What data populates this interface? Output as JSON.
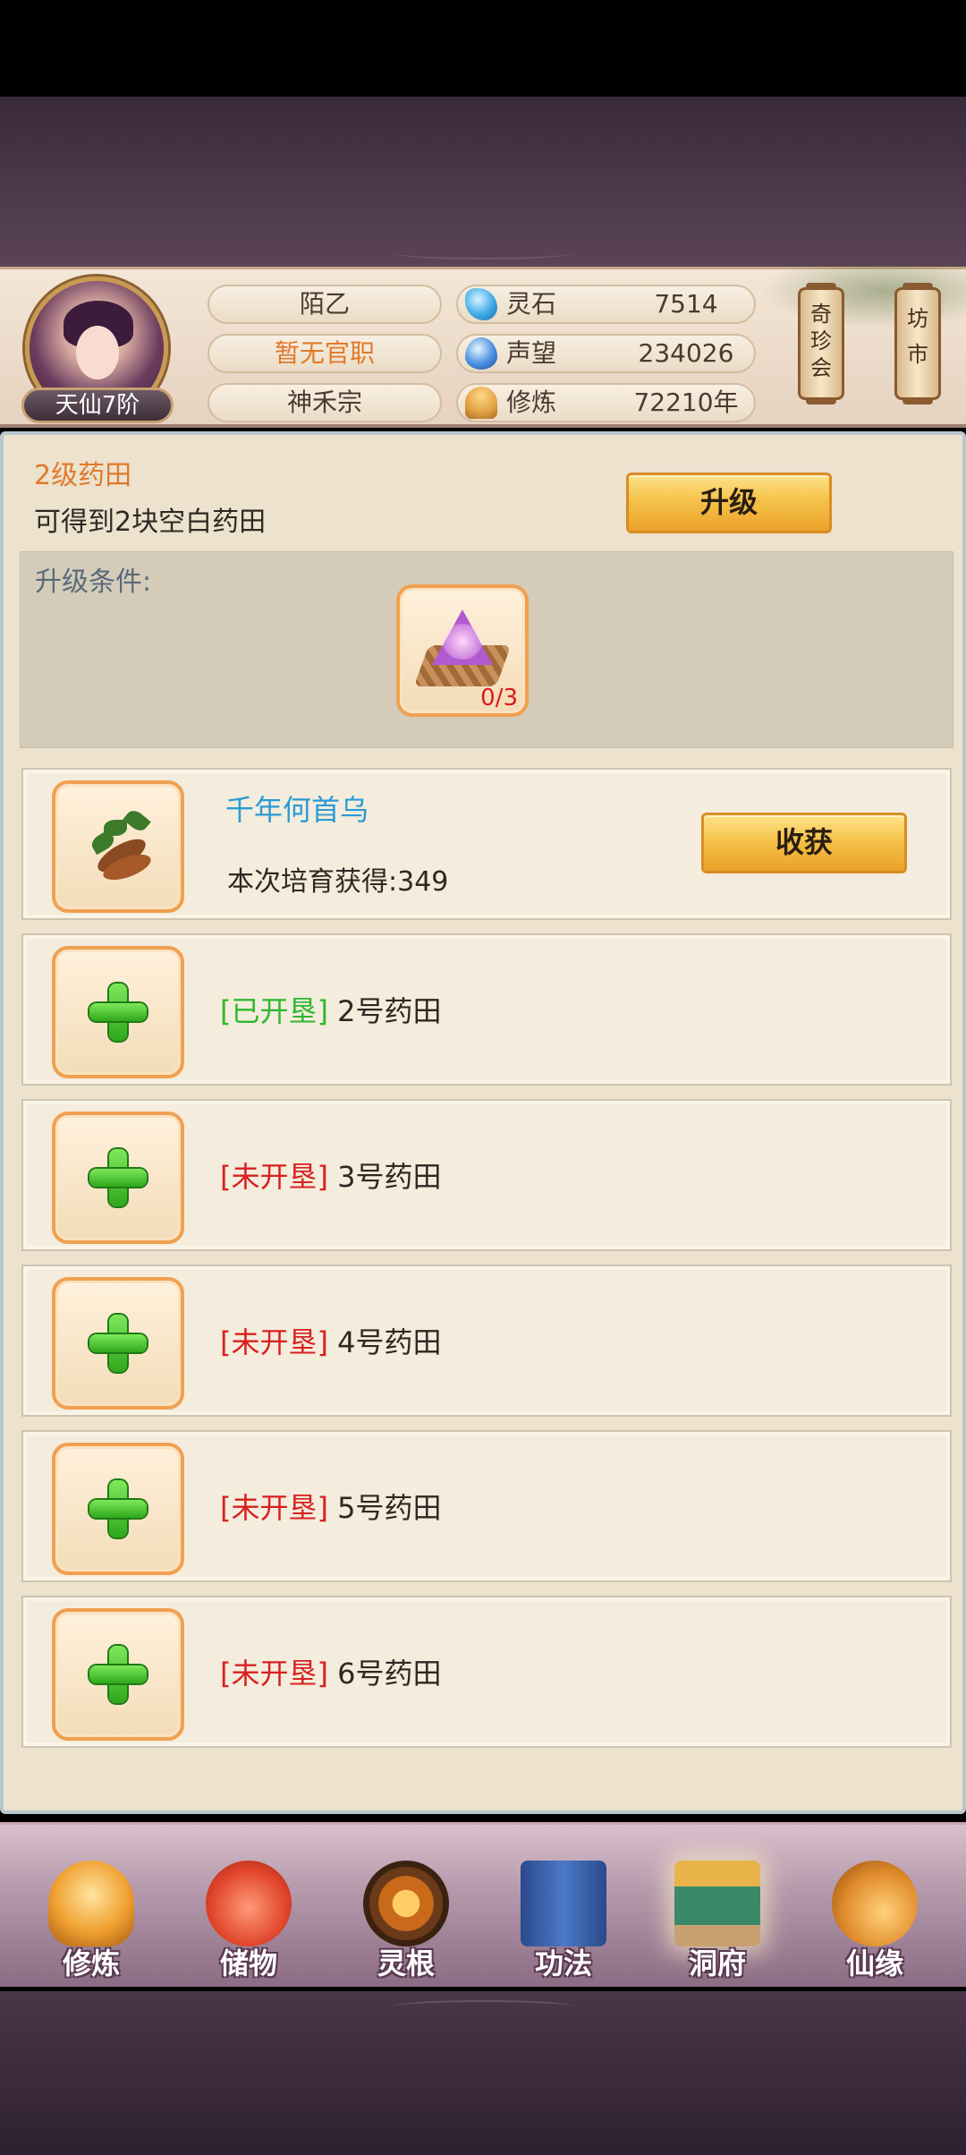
{
  "header": {
    "rank": "天仙7阶",
    "name": "陌乙",
    "title": "暂无官职",
    "sect": "神禾宗",
    "stats": [
      {
        "label": "灵石",
        "value": "7514",
        "icon": "spirit-stone-icon"
      },
      {
        "label": "声望",
        "value": "234026",
        "icon": "reputation-icon"
      },
      {
        "label": "修炼",
        "value": "72210年",
        "icon": "cultivation-icon"
      }
    ],
    "side_buttons": [
      {
        "label": "奇珍会"
      },
      {
        "label": "坊市"
      }
    ]
  },
  "upgrade": {
    "level_title": "2级药田",
    "description": "可得到2块空白药田",
    "button_label": "升级",
    "condition_label": "升级条件:",
    "material_qty": "0/3"
  },
  "harvest_field": {
    "herb_name": "千年何首乌",
    "gain_text": "本次培育获得:349",
    "button_label": "收获"
  },
  "fields": [
    {
      "tag": "[已开垦]",
      "name": "2号药田",
      "status": "open"
    },
    {
      "tag": "[未开垦]",
      "name": "3号药田",
      "status": "closed"
    },
    {
      "tag": "[未开垦]",
      "name": "4号药田",
      "status": "closed"
    },
    {
      "tag": "[未开垦]",
      "name": "5号药田",
      "status": "closed"
    },
    {
      "tag": "[未开垦]",
      "name": "6号药田",
      "status": "closed"
    }
  ],
  "colors": {
    "open_tag": "#2eb82e",
    "closed_tag": "#d82020",
    "herb_name": "#2a9ad6",
    "accent_orange": "#e07a2a"
  },
  "bottom_nav": [
    {
      "label": "修炼",
      "icon": "cultivate-icon"
    },
    {
      "label": "储物",
      "icon": "storage-bag-icon"
    },
    {
      "label": "灵根",
      "icon": "spirit-root-icon"
    },
    {
      "label": "功法",
      "icon": "technique-book-icon"
    },
    {
      "label": "洞府",
      "icon": "cave-dwelling-icon",
      "active": true
    },
    {
      "label": "仙缘",
      "icon": "fate-gourd-icon"
    }
  ]
}
